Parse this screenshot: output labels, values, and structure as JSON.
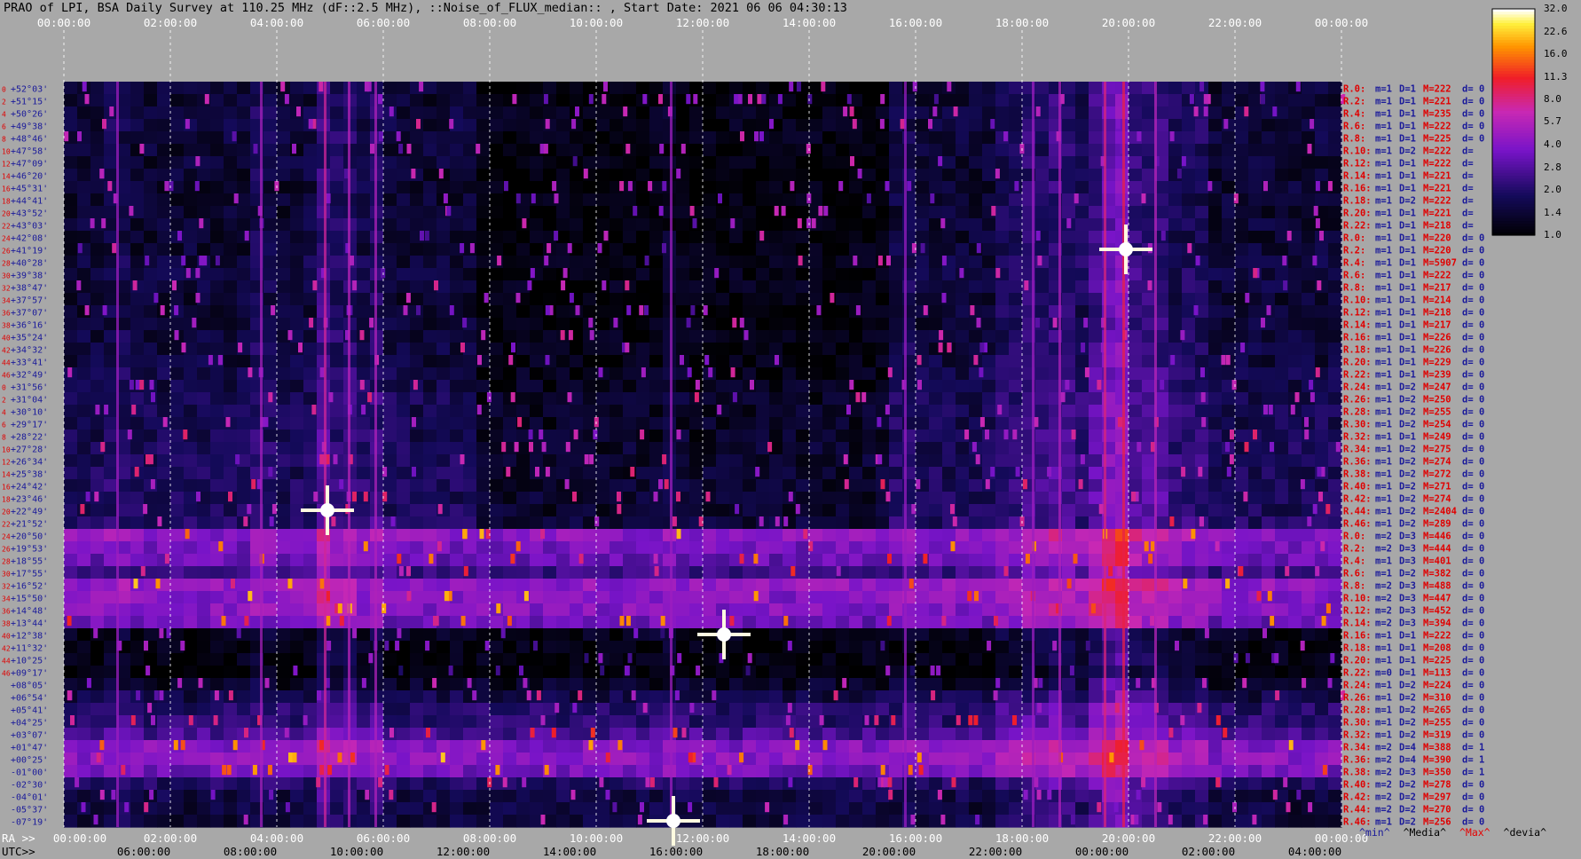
{
  "title": "PRAO of LPI, BSA Daily Survey at 110.25 MHz (dF::2.5 MHz), ::Noise_of_FLUX_median:: , Start Date: 2021 06 06 04:30:13",
  "top_axis_ticks": [
    "00:00:00",
    "02:00:00",
    "04:00:00",
    "06:00:00",
    "08:00:00",
    "10:00:00",
    "12:00:00",
    "14:00:00",
    "16:00:00",
    "18:00:00",
    "20:00:00",
    "22:00:00",
    "00:00:00"
  ],
  "ra_axis": {
    "prefix": "RA >>",
    "ticks": [
      "00:00:00",
      "02:00:00",
      "04:00:00",
      "06:00:00",
      "08:00:00",
      "10:00:00",
      "12:00:00",
      "14:00:00",
      "16:00:00",
      "18:00:00",
      "20:00:00",
      "22:00:00",
      "00:00:00"
    ]
  },
  "utc_axis": {
    "prefix": "UTC>>",
    "ticks": [
      "06:00:00",
      "08:00:00",
      "10:00:00",
      "12:00:00",
      "14:00:00",
      "16:00:00",
      "18:00:00",
      "20:00:00",
      "22:00:00",
      "00:00:00",
      "02:00:00",
      "04:00:00"
    ]
  },
  "chart_data": {
    "type": "heatmap",
    "title": "PRAO of LPI, BSA Daily Survey at 110.25 MHz (dF::2.5 MHz), ::Noise_of_FLUX_median:: , Start Date: 2021 06 06 04:30:13",
    "xlabel": "RA / UTC",
    "x_range_hours": [
      0,
      24
    ],
    "color_scale": {
      "type": "log",
      "ticks": [
        32.0,
        22.6,
        16.0,
        11.3,
        8.0,
        5.7,
        4.0,
        2.8,
        2.0,
        1.4,
        1.0
      ],
      "tick_labels": [
        "32.0",
        "22.6",
        "16.0",
        "11.3",
        "8.0",
        "5.7",
        "4.0",
        "2.8",
        "2.0",
        "1.4",
        "1.0"
      ],
      "colormap": "gnuplot-heat (black-blue-purple-red-yellow-white)"
    },
    "beam_index_labels": [
      "0",
      "2",
      "4",
      "6",
      "8",
      "10",
      "12",
      "14",
      "16",
      "18",
      "20",
      "22",
      "24",
      "26",
      "28",
      "30",
      "32",
      "34",
      "36",
      "38",
      "40",
      "42",
      "44",
      "46",
      "0",
      "2",
      "4",
      "6",
      "8",
      "10",
      "12",
      "14",
      "16",
      "18",
      "20",
      "22",
      "24",
      "26",
      "28",
      "30",
      "32",
      "34",
      "36",
      "38",
      "40",
      "42",
      "44",
      "46"
    ],
    "declinations": [
      "+52°03'",
      "+51°15'",
      "+50°26'",
      "+49°38'",
      "+48°46'",
      "+47°58'",
      "+47°09'",
      "+46°20'",
      "+45°31'",
      "+44°41'",
      "+43°52'",
      "+43°03'",
      "+42°08'",
      "+41°19'",
      "+40°28'",
      "+39°38'",
      "+38°47'",
      "+37°57'",
      "+37°07'",
      "+36°16'",
      "+35°24'",
      "+34°32'",
      "+33°41'",
      "+32°49'",
      "+31°56'",
      "+31°04'",
      "+30°10'",
      "+29°17'",
      "+28°22'",
      "+27°28'",
      "+26°34'",
      "+25°38'",
      "+24°42'",
      "+23°46'",
      "+22°49'",
      "+21°52'",
      "+20°50'",
      "+19°53'",
      "+18°55'",
      "+17°55'",
      "+16°52'",
      "+15°50'",
      "+14°48'",
      "+13°44'",
      "+12°38'",
      "+11°32'",
      "+10°25'",
      "+09°17'",
      "+08°05'",
      "+06°54'",
      "+05°41'",
      "+04°25'",
      "+03°07'",
      "+01°47'",
      "+00°25'",
      "-01°00'",
      "-02°30'",
      "-04°01'",
      "-05°37'",
      "-07°19'"
    ],
    "row_stats": [
      [
        "R.0:",
        "m=1",
        "D=1",
        "M=222",
        "d= 0"
      ],
      [
        "R.2:",
        "m=1",
        "D=1",
        "M=221",
        "d= 0"
      ],
      [
        "R.4:",
        "m=1",
        "D=1",
        "M=235",
        "d= 0"
      ],
      [
        "R.6:",
        "m=1",
        "D=1",
        "M=222",
        "d= 0"
      ],
      [
        "R.8:",
        "m=1",
        "D=1",
        "M=225",
        "d= 0"
      ],
      [
        "R.10:",
        "m=1",
        "D=2",
        "M=222",
        "d="
      ],
      [
        "R.12:",
        "m=1",
        "D=1",
        "M=222",
        "d="
      ],
      [
        "R.14:",
        "m=1",
        "D=1",
        "M=221",
        "d="
      ],
      [
        "R.16:",
        "m=1",
        "D=1",
        "M=221",
        "d="
      ],
      [
        "R.18:",
        "m=1",
        "D=2",
        "M=222",
        "d="
      ],
      [
        "R.20:",
        "m=1",
        "D=1",
        "M=221",
        "d="
      ],
      [
        "R.22:",
        "m=1",
        "D=1",
        "M=218",
        "d="
      ],
      [
        "R.0:",
        "m=1",
        "D=1",
        "M=220",
        "d= 0"
      ],
      [
        "R.2:",
        "m=1",
        "D=1",
        "M=220",
        "d= 0"
      ],
      [
        "R.4:",
        "m=1",
        "D=1",
        "M=5907",
        "d= 0"
      ],
      [
        "R.6:",
        "m=1",
        "D=1",
        "M=222",
        "d= 0"
      ],
      [
        "R.8:",
        "m=1",
        "D=1",
        "M=217",
        "d= 0"
      ],
      [
        "R.10:",
        "m=1",
        "D=1",
        "M=214",
        "d= 0"
      ],
      [
        "R.12:",
        "m=1",
        "D=1",
        "M=218",
        "d= 0"
      ],
      [
        "R.14:",
        "m=1",
        "D=1",
        "M=217",
        "d= 0"
      ],
      [
        "R.16:",
        "m=1",
        "D=1",
        "M=226",
        "d= 0"
      ],
      [
        "R.18:",
        "m=1",
        "D=1",
        "M=226",
        "d= 0"
      ],
      [
        "R.20:",
        "m=1",
        "D=1",
        "M=229",
        "d= 0"
      ],
      [
        "R.22:",
        "m=1",
        "D=1",
        "M=239",
        "d= 0"
      ],
      [
        "R.24:",
        "m=1",
        "D=2",
        "M=247",
        "d= 0"
      ],
      [
        "R.26:",
        "m=1",
        "D=2",
        "M=250",
        "d= 0"
      ],
      [
        "R.28:",
        "m=1",
        "D=2",
        "M=255",
        "d= 0"
      ],
      [
        "R.30:",
        "m=1",
        "D=2",
        "M=254",
        "d= 0"
      ],
      [
        "R.32:",
        "m=1",
        "D=1",
        "M=249",
        "d= 0"
      ],
      [
        "R.34:",
        "m=1",
        "D=2",
        "M=275",
        "d= 0"
      ],
      [
        "R.36:",
        "m=1",
        "D=2",
        "M=274",
        "d= 0"
      ],
      [
        "R.38:",
        "m=1",
        "D=2",
        "M=272",
        "d= 0"
      ],
      [
        "R.40:",
        "m=1",
        "D=2",
        "M=271",
        "d= 0"
      ],
      [
        "R.42:",
        "m=1",
        "D=2",
        "M=274",
        "d= 0"
      ],
      [
        "R.44:",
        "m=1",
        "D=2",
        "M=2404",
        "d= 0"
      ],
      [
        "R.46:",
        "m=1",
        "D=2",
        "M=289",
        "d= 0"
      ],
      [
        "R.0:",
        "m=2",
        "D=3",
        "M=446",
        "d= 0"
      ],
      [
        "R.2:",
        "m=2",
        "D=3",
        "M=444",
        "d= 0"
      ],
      [
        "R.4:",
        "m=1",
        "D=3",
        "M=401",
        "d= 0"
      ],
      [
        "R.6:",
        "m=1",
        "D=2",
        "M=382",
        "d= 0"
      ],
      [
        "R.8:",
        "m=2",
        "D=3",
        "M=488",
        "d= 0"
      ],
      [
        "R.10:",
        "m=2",
        "D=3",
        "M=447",
        "d= 0"
      ],
      [
        "R.12:",
        "m=2",
        "D=3",
        "M=452",
        "d= 0"
      ],
      [
        "R.14:",
        "m=2",
        "D=3",
        "M=394",
        "d= 0"
      ],
      [
        "R.16:",
        "m=1",
        "D=1",
        "M=222",
        "d= 0"
      ],
      [
        "R.18:",
        "m=1",
        "D=1",
        "M=208",
        "d= 0"
      ],
      [
        "R.20:",
        "m=1",
        "D=1",
        "M=225",
        "d= 0"
      ],
      [
        "R.22:",
        "m=0",
        "D=1",
        "M=113",
        "d= 0"
      ],
      [
        "R.24:",
        "m=1",
        "D=2",
        "M=224",
        "d= 0"
      ],
      [
        "R.26:",
        "m=1",
        "D=2",
        "M=310",
        "d= 0"
      ],
      [
        "R.28:",
        "m=1",
        "D=2",
        "M=265",
        "d= 0"
      ],
      [
        "R.30:",
        "m=1",
        "D=2",
        "M=255",
        "d= 0"
      ],
      [
        "R.32:",
        "m=1",
        "D=2",
        "M=319",
        "d= 0"
      ],
      [
        "R.34:",
        "m=2",
        "D=4",
        "M=388",
        "d= 1"
      ],
      [
        "R.36:",
        "m=2",
        "D=4",
        "M=390",
        "d= 1"
      ],
      [
        "R.38:",
        "m=2",
        "D=3",
        "M=350",
        "d= 1"
      ],
      [
        "R.40:",
        "m=2",
        "D=2",
        "M=278",
        "d= 0"
      ],
      [
        "R.42:",
        "m=2",
        "D=2",
        "M=297",
        "d= 0"
      ],
      [
        "R.44:",
        "m=2",
        "D=2",
        "M=270",
        "d= 0"
      ],
      [
        "R.46:",
        "m=1",
        "D=2",
        "M=256",
        "d= 0"
      ]
    ],
    "row_mean_level": [
      1.4,
      1.4,
      1.5,
      1.5,
      1.5,
      1.4,
      1.4,
      1.4,
      1.4,
      1.4,
      1.4,
      1.4,
      1.4,
      1.4,
      1.5,
      1.5,
      1.5,
      1.4,
      1.4,
      1.4,
      1.5,
      1.5,
      1.5,
      1.6,
      1.6,
      1.7,
      1.7,
      1.7,
      1.7,
      1.8,
      1.8,
      1.8,
      1.8,
      1.8,
      1.8,
      1.9,
      4.2,
      3.6,
      3.3,
      2.4,
      4.4,
      4.1,
      4.0,
      3.4,
      1.2,
      1.1,
      1.1,
      1.0,
      1.3,
      1.6,
      2.0,
      2.1,
      2.6,
      4.0,
      4.2,
      3.6,
      1.9,
      1.6,
      1.5,
      1.5
    ],
    "vertical_features_hours": [
      {
        "x": 4.9,
        "intensity": 3.0
      },
      {
        "x": 5.35,
        "intensity": 2.2
      },
      {
        "x": 5.85,
        "intensity": 2.0
      },
      {
        "x": 3.7,
        "intensity": 1.8
      },
      {
        "x": 1.0,
        "intensity": 1.6
      },
      {
        "x": 19.55,
        "intensity": 3.5
      },
      {
        "x": 19.9,
        "intensity": 4.5
      },
      {
        "x": 20.5,
        "intensity": 2.2
      },
      {
        "x": 18.7,
        "intensity": 2.0
      },
      {
        "x": 18.2,
        "intensity": 1.6
      },
      {
        "x": 15.8,
        "intensity": 1.5
      },
      {
        "x": 11.4,
        "intensity": 1.6
      }
    ],
    "point_sources": [
      {
        "x_hours": 4.95,
        "dec": "+22°49'",
        "level": 32.0
      },
      {
        "x_hours": 19.95,
        "dec": "+41°19'",
        "level": 32.0
      },
      {
        "x_hours": 12.4,
        "dec": "+12°38'",
        "level": 22.6
      },
      {
        "x_hours": 11.45,
        "dec": "-07°19'",
        "level": 22.6
      }
    ],
    "grid": true
  },
  "footer_legend": {
    "min": "^min^",
    "median": "^Media^",
    "max": "^Max^",
    "dev": "^devia^"
  }
}
